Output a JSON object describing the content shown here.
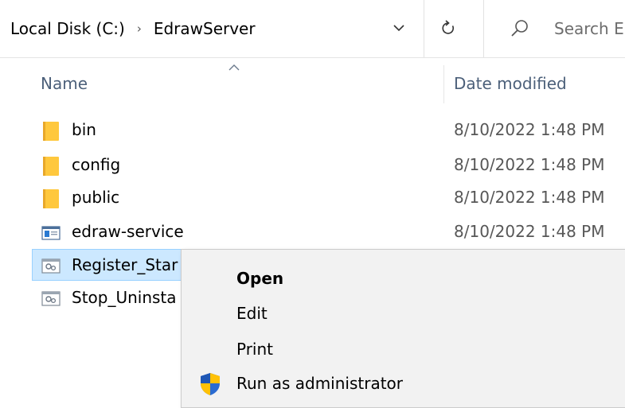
{
  "address": {
    "crumbs": [
      "Local Disk (C:)",
      "EdrawServer"
    ],
    "separator": "›",
    "search_placeholder": "Search E"
  },
  "columns": {
    "name": "Name",
    "date_modified": "Date modified"
  },
  "files": [
    {
      "name": "bin",
      "date": "8/10/2022 1:48 PM",
      "icon": "folder-icon"
    },
    {
      "name": "config",
      "date": "8/10/2022 1:48 PM",
      "icon": "folder-icon"
    },
    {
      "name": "public",
      "date": "8/10/2022 1:48 PM",
      "icon": "folder-icon"
    },
    {
      "name": "edraw-service",
      "date": "8/10/2022 1:48 PM",
      "icon": "application-icon"
    },
    {
      "name": "Register_Star",
      "date": "",
      "icon": "batch-file-icon"
    },
    {
      "name": "Stop_Uninsta",
      "date": "",
      "icon": "batch-file-icon"
    }
  ],
  "context_menu": {
    "items": [
      {
        "label": "Open",
        "bold": true
      },
      {
        "label": "Edit"
      },
      {
        "label": "Print"
      },
      {
        "label": "Run as administrator",
        "icon": "uac-shield-icon"
      }
    ]
  },
  "colors": {
    "selection_bg": "#cce8ff",
    "selection_border": "#99d1ff",
    "header_text": "#4c607a",
    "folder_yellow": "#ffc83d",
    "menu_bg": "#f2f2f2"
  }
}
